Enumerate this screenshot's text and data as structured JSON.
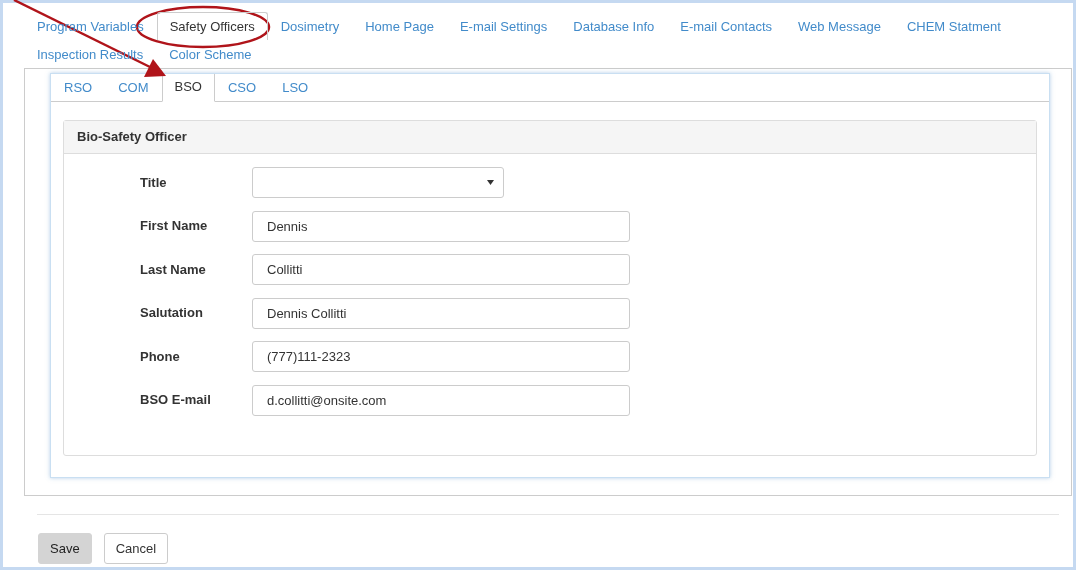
{
  "nav_tabs": [
    {
      "label": "Program Variables",
      "selected": false
    },
    {
      "label": "Safety Officers",
      "selected": true
    },
    {
      "label": "Dosimetry",
      "selected": false
    },
    {
      "label": "Home Page",
      "selected": false
    },
    {
      "label": "E-mail Settings",
      "selected": false
    },
    {
      "label": "Database Info",
      "selected": false
    },
    {
      "label": "E-mail Contacts",
      "selected": false
    },
    {
      "label": "Web Message",
      "selected": false
    },
    {
      "label": "CHEM Statment",
      "selected": false
    },
    {
      "label": "Inspection Results",
      "selected": false
    },
    {
      "label": "Color Scheme",
      "selected": false
    }
  ],
  "sub_tabs": [
    {
      "label": "RSO",
      "selected": false
    },
    {
      "label": "COM",
      "selected": false
    },
    {
      "label": "BSO",
      "selected": true
    },
    {
      "label": "CSO",
      "selected": false
    },
    {
      "label": "LSO",
      "selected": false
    }
  ],
  "panel": {
    "title": "Bio-Safety Officer",
    "fields": [
      {
        "kind": "select",
        "label": "Title"
      },
      {
        "kind": "text",
        "label": "First Name",
        "value": "Dennis"
      },
      {
        "kind": "text",
        "label": "Last Name",
        "value": "Collitti"
      },
      {
        "kind": "text",
        "label": "Salutation",
        "value": "Dennis Collitti"
      },
      {
        "kind": "text",
        "label": "Phone",
        "value": "(777)111-2323"
      },
      {
        "kind": "text",
        "label": "BSO E-mail",
        "value": "d.collitti@onsite.com"
      }
    ]
  },
  "buttons": [
    {
      "kind": "primary",
      "label": "Save"
    },
    {
      "kind": "default",
      "label": "Cancel"
    }
  ]
}
